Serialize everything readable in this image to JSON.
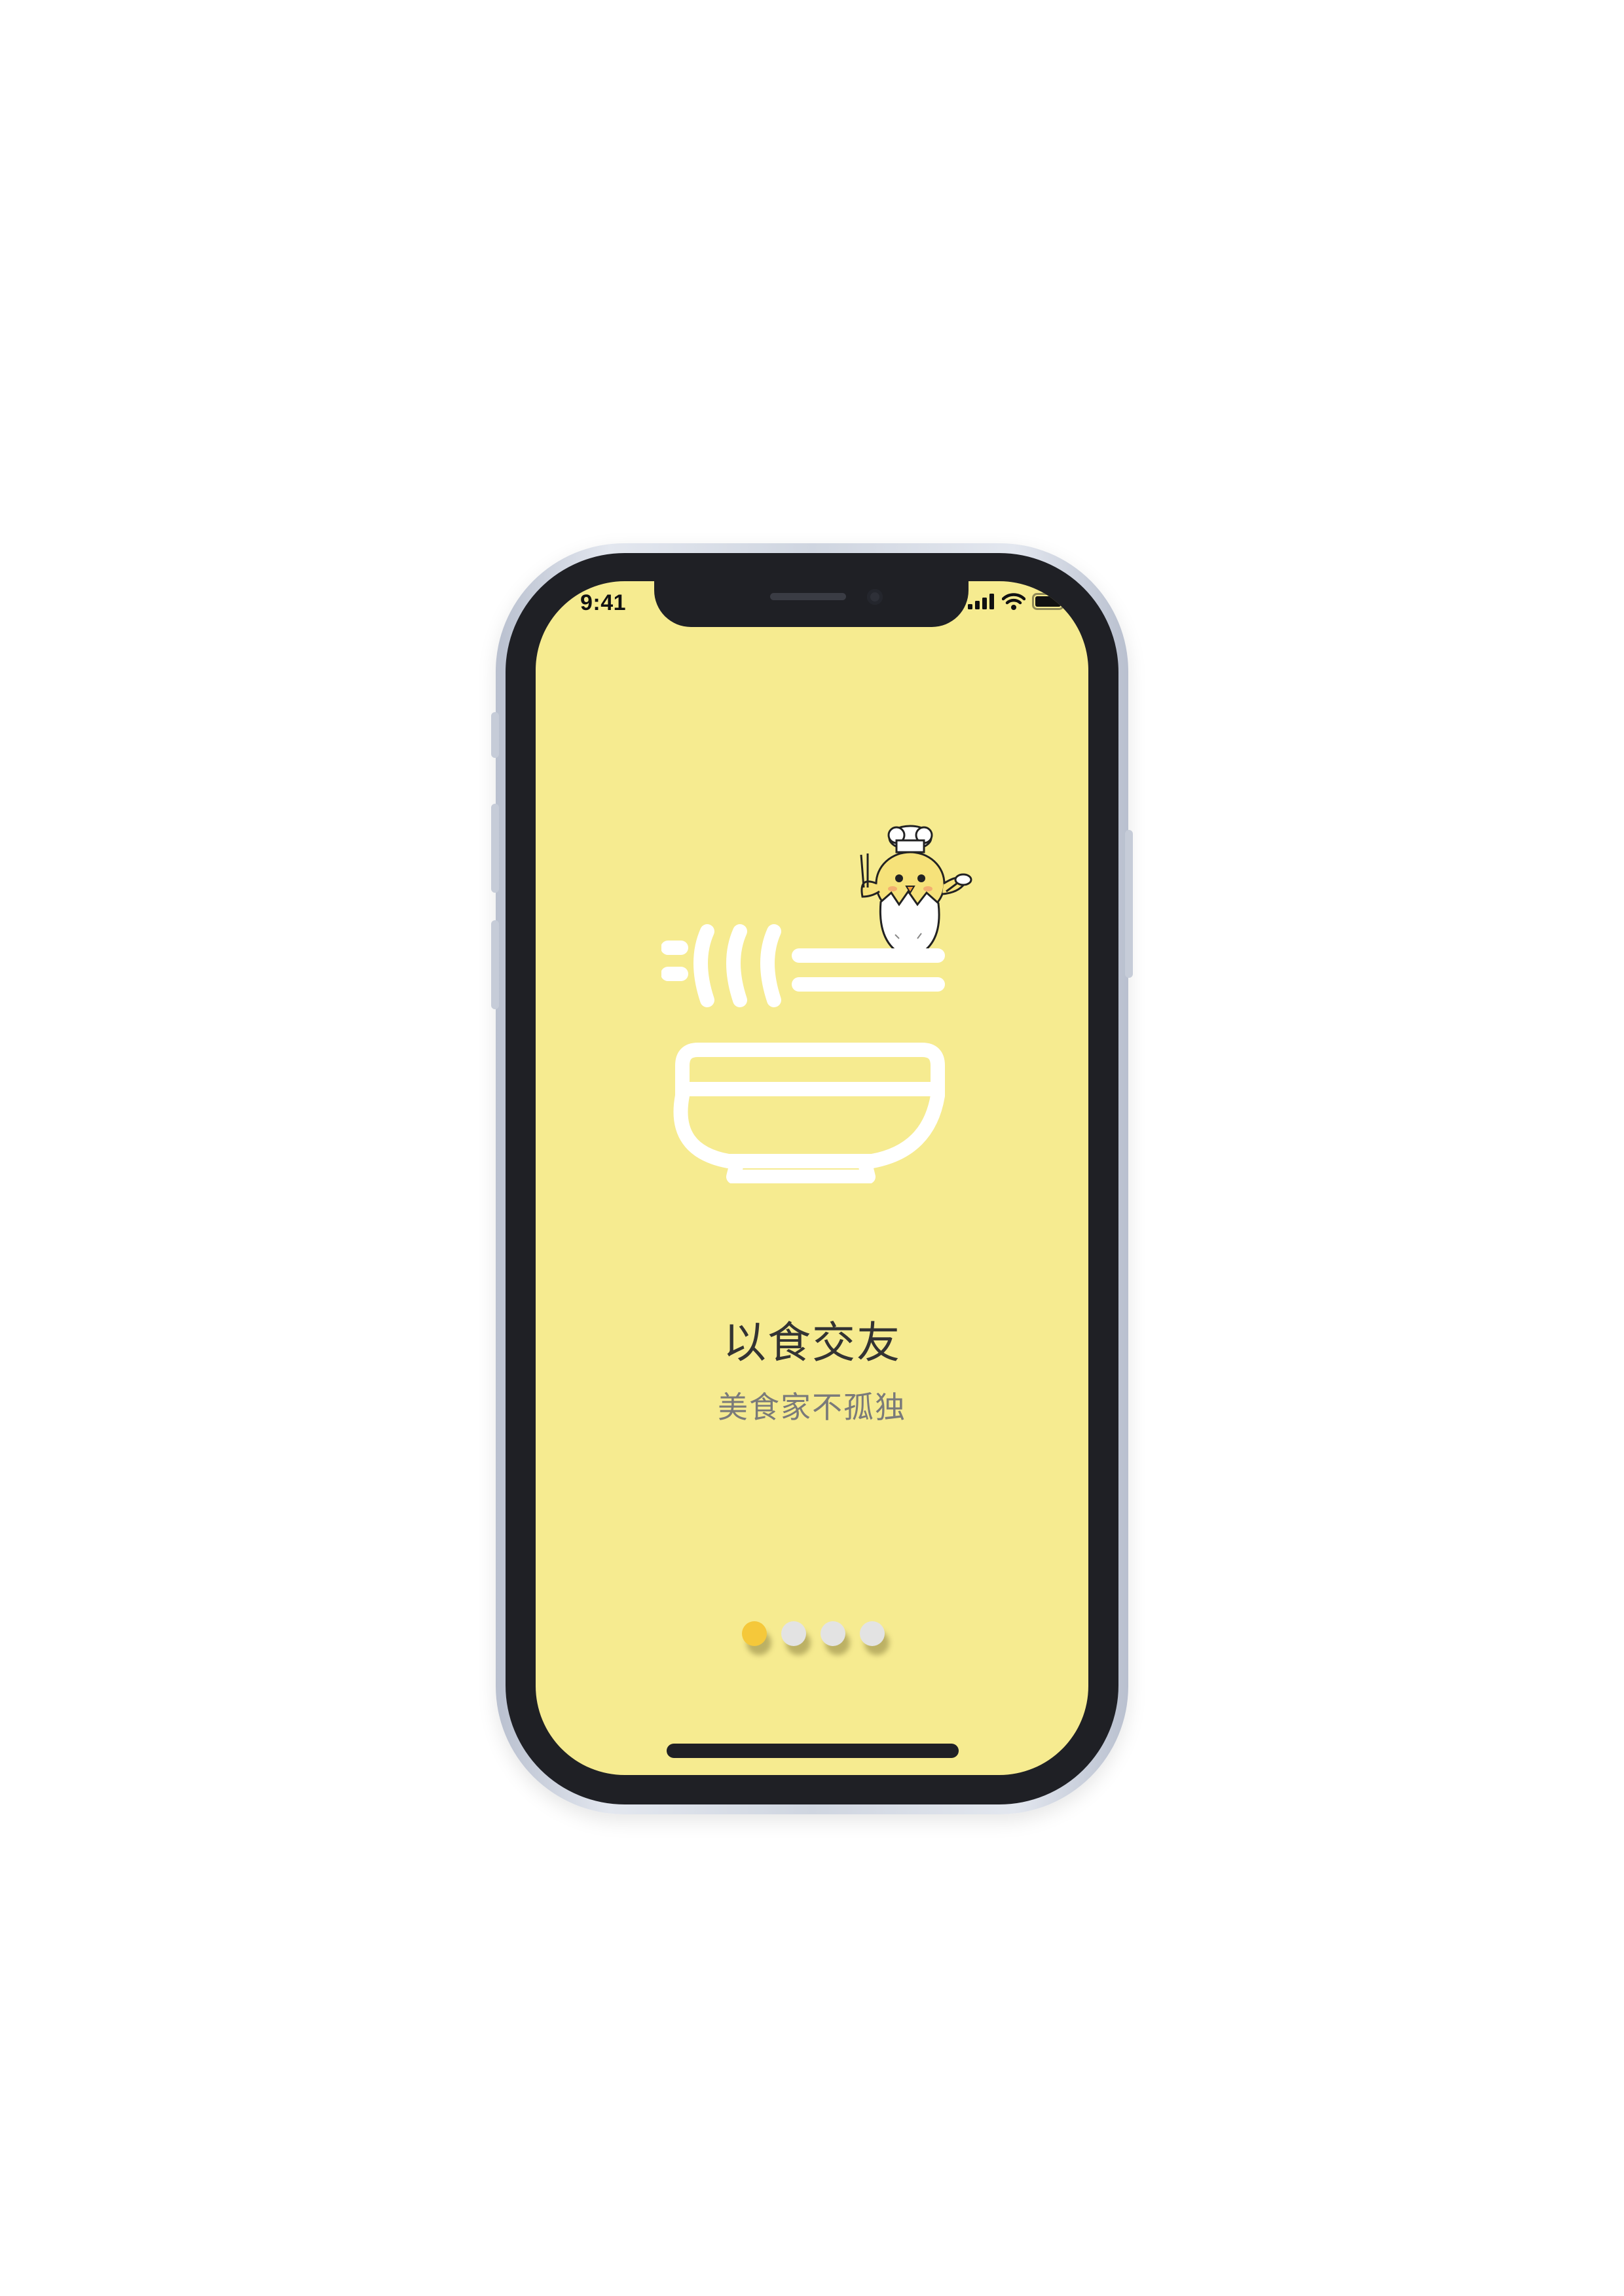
{
  "status_bar": {
    "time": "9:41",
    "icons": [
      "signal-icon",
      "wifi-icon",
      "battery-icon"
    ]
  },
  "onboarding": {
    "title": "以食交友",
    "subtitle": "美食家不孤独",
    "illustration": "noodle-bowl-icon",
    "mascot": "chick-chef-mascot"
  },
  "pager": {
    "total_pages": 4,
    "current_page": 1
  },
  "colors": {
    "screen_background": "#f6eb90",
    "icon_stroke": "#ffffff",
    "pager_active": "#f5c83a",
    "pager_inactive": "#e3e3e3",
    "title_text": "#333333",
    "subtitle_text": "#7a7a7a"
  }
}
